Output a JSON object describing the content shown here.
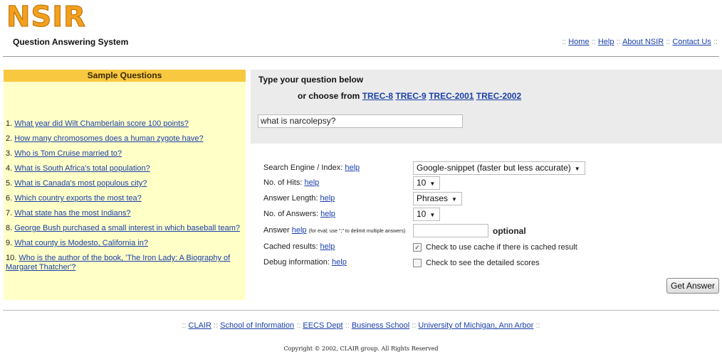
{
  "header": {
    "logo": "NSIR",
    "subtitle": "Question Answering System",
    "nav": [
      "Home",
      "Help",
      "About NSIR",
      "Contact Us"
    ]
  },
  "sample": {
    "title": "Sample Questions",
    "questions": [
      {
        "num": "1.",
        "text": "What year did Wilt Chamberlain score 100 points?"
      },
      {
        "num": "2.",
        "text": "How many chromosomes does a human zygote have?"
      },
      {
        "num": "3.",
        "text": "Who is Tom Cruise married to?"
      },
      {
        "num": "4.",
        "text": "What is South Africa's total population?"
      },
      {
        "num": "5.",
        "text": "What is Canada's most populous city?"
      },
      {
        "num": "6.",
        "text": "Which country exports the most tea?"
      },
      {
        "num": "7.",
        "text": "What state has the most Indians?"
      },
      {
        "num": "8.",
        "text": "George Bush purchased a small interest in which baseball team?"
      },
      {
        "num": "9.",
        "text": "What county is Modesto, California in?"
      },
      {
        "num": "10.",
        "text": "Who is the author of the book, 'The Iron Lady: A Biography of Margaret Thatcher'?"
      }
    ]
  },
  "query": {
    "prompt": "Type your question below",
    "choose_prefix": "or choose from",
    "trec_links": [
      "TREC-8",
      "TREC-9",
      "TREC-2001",
      "TREC-2002"
    ],
    "question_value": "what is narcolepsy?"
  },
  "form": {
    "help": "help",
    "engine_label": "Search Engine / Index:",
    "engine_value": "Google-snippet (faster but less accurate)",
    "hits_label": "No. of Hits:",
    "hits_value": "10",
    "length_label": "Answer Length:",
    "length_value": "Phrases",
    "answers_label": "No. of Answers:",
    "answers_value": "10",
    "answer_label": "Answer",
    "answer_note": "(for eval; use \";\" to delimit multiple answers)",
    "optional": "optional",
    "cached_label": "Cached results:",
    "cached_text": "Check to use cache if there is cached result",
    "cached_checked": true,
    "debug_label": "Debug information:",
    "debug_text": "Check to see the detailed scores",
    "debug_checked": false,
    "submit": "Get Answer"
  },
  "footer": {
    "links": [
      "CLAIR",
      "School of Information",
      "EECS Dept",
      "Business School",
      "University of Michigan, Ann Arbor"
    ],
    "copyright": "Copyright © 2002, CLAIR group. All Rights Reserved"
  },
  "colors": {
    "logo": "#f2a01e",
    "sample_bg": "#ffffc8",
    "sample_header": "#f9c841",
    "link": "#1a3fa8"
  }
}
